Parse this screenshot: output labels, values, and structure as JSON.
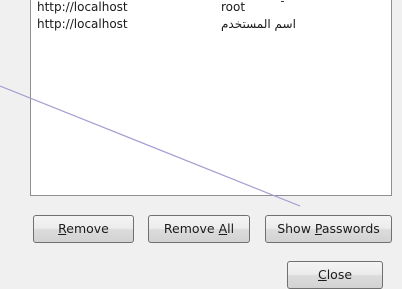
{
  "passwords_list": {
    "rows": [
      {
        "site": "http://localhost",
        "username": "root"
      },
      {
        "site": "http://localhost",
        "username": "اسم المستخدم"
      }
    ]
  },
  "buttons": {
    "remove": {
      "before": "",
      "mnemonic": "R",
      "after": "emove"
    },
    "remove_all": {
      "before": "Remove ",
      "mnemonic": "A",
      "after": "ll"
    },
    "show_passwords": {
      "before": "Show ",
      "mnemonic": "P",
      "after": "asswords"
    },
    "close": {
      "before": "",
      "mnemonic": "C",
      "after": "lose"
    }
  },
  "annotation": {
    "color": "#a69ad0"
  },
  "colors": {
    "list_border": "#8e8f8f",
    "button_border": "#707070"
  }
}
